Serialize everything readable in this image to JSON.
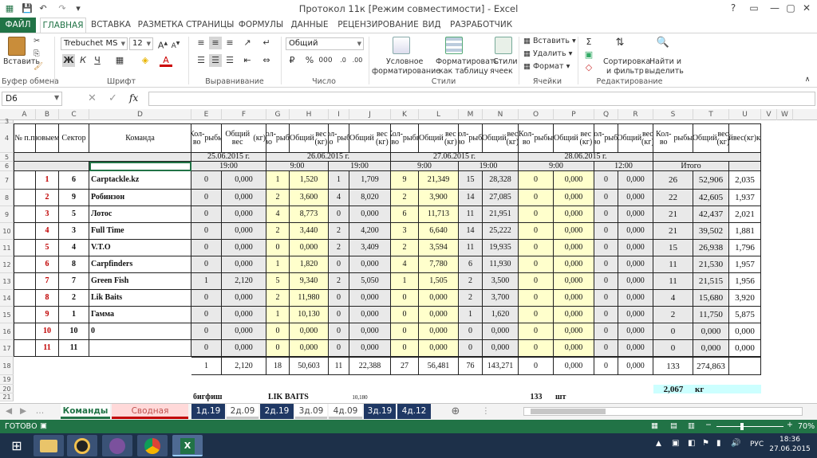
{
  "window": {
    "title": "Протокол 11к  [Режим совместимости] - Excel",
    "help": "?",
    "min": "—",
    "max": "▢",
    "close": "✕"
  },
  "ribbon_tabs": [
    "ФАЙЛ",
    "ГЛАВНАЯ",
    "ВСТАВКА",
    "РАЗМЕТКА СТРАНИЦЫ",
    "ФОРМУЛЫ",
    "ДАННЫЕ",
    "РЕЦЕНЗИРОВАНИЕ",
    "ВИД",
    "РАЗРАБОТЧИК"
  ],
  "ribbon": {
    "paste": "Вставить",
    "clipboard": "Буфер обмена",
    "font_name": "Trebuchet MS",
    "font_size": "12",
    "bold": "Ж",
    "italic": "К",
    "underline": "Ч",
    "font_group": "Шрифт",
    "align_group": "Выравнивание",
    "number_format": "Общий",
    "percent": "%",
    "thousands": "000",
    "number_group": "Число",
    "cond_format": [
      "Условное",
      "форматирование"
    ],
    "format_table": [
      "Форматировать",
      "как таблицу"
    ],
    "cell_styles": [
      "Стили",
      "ячеек"
    ],
    "styles_group": "Стили",
    "insert": "Вставить",
    "delete": "Удалить",
    "format": "Формат",
    "cells_group": "Ячейки",
    "sort": [
      "Сортировка",
      "и фильтр"
    ],
    "find": [
      "Найти и",
      "выделить"
    ],
    "edit_group": "Редактирование"
  },
  "formula_bar": {
    "name_box": "D6",
    "fx": "fx",
    "content": ""
  },
  "columns": [
    "A",
    "B",
    "C",
    "D",
    "E",
    "F",
    "G",
    "H",
    "I",
    "J",
    "K",
    "L",
    "M",
    "N",
    "O",
    "P",
    "Q",
    "R",
    "S",
    "T",
    "U",
    "V",
    "W"
  ],
  "rows": [
    "3",
    "4",
    "5",
    "6",
    "7",
    "8",
    "9",
    "10",
    "11",
    "12",
    "13",
    "14",
    "15",
    "16",
    "17",
    "18",
    "19",
    "20",
    "21"
  ],
  "header": {
    "num": "№ п.п",
    "place": [
      "Призо",
      "вые",
      "места"
    ],
    "sector": "Сектор",
    "team": "Команда",
    "kolvo": [
      "Кол-во",
      "рыбы"
    ],
    "ves": [
      "Общий",
      "вес (кг)"
    ],
    "ves_f": [
      "Общий вес",
      "(кг)"
    ],
    "avg": [
      "Средний",
      "вес(кг)",
      "команды"
    ],
    "dates": [
      "25.06.2015 г.",
      "26.06.2015 г.",
      "27.06.2015 г.",
      "28.06.2015 г."
    ],
    "times": [
      "19:00",
      "9:00",
      "19:00",
      "9:00",
      "19:00",
      "9:00",
      "12:00"
    ],
    "total": "Итого"
  },
  "table_rows": [
    {
      "place": "1",
      "sector": "6",
      "team": "Carptackle.kz",
      "v": [
        "0",
        "0,000",
        "1",
        "1,520",
        "1",
        "1,709",
        "9",
        "21,349",
        "15",
        "28,328",
        "0",
        "0,000",
        "0",
        "0,000",
        "26",
        "52,906",
        "2,035"
      ]
    },
    {
      "place": "2",
      "sector": "9",
      "team": "Робинзон",
      "v": [
        "0",
        "0,000",
        "2",
        "3,600",
        "4",
        "8,020",
        "2",
        "3,900",
        "14",
        "27,085",
        "0",
        "0,000",
        "0",
        "0,000",
        "22",
        "42,605",
        "1,937"
      ]
    },
    {
      "place": "3",
      "sector": "5",
      "team": "Лотос",
      "v": [
        "0",
        "0,000",
        "4",
        "8,773",
        "0",
        "0,000",
        "6",
        "11,713",
        "11",
        "21,951",
        "0",
        "0,000",
        "0",
        "0,000",
        "21",
        "42,437",
        "2,021"
      ]
    },
    {
      "place": "4",
      "sector": "3",
      "team": "Full Time",
      "v": [
        "0",
        "0,000",
        "2",
        "3,440",
        "2",
        "4,200",
        "3",
        "6,640",
        "14",
        "25,222",
        "0",
        "0,000",
        "0",
        "0,000",
        "21",
        "39,502",
        "1,881"
      ]
    },
    {
      "place": "5",
      "sector": "4",
      "team": "V.T.O",
      "v": [
        "0",
        "0,000",
        "0",
        "0,000",
        "2",
        "3,409",
        "2",
        "3,594",
        "11",
        "19,935",
        "0",
        "0,000",
        "0",
        "0,000",
        "15",
        "26,938",
        "1,796"
      ]
    },
    {
      "place": "6",
      "sector": "8",
      "team": "Carpfinders",
      "v": [
        "0",
        "0,000",
        "1",
        "1,820",
        "0",
        "0,000",
        "4",
        "7,780",
        "6",
        "11,930",
        "0",
        "0,000",
        "0",
        "0,000",
        "11",
        "21,530",
        "1,957"
      ]
    },
    {
      "place": "7",
      "sector": "7",
      "team": "Green Fish",
      "v": [
        "1",
        "2,120",
        "5",
        "9,340",
        "2",
        "5,050",
        "1",
        "1,505",
        "2",
        "3,500",
        "0",
        "0,000",
        "0",
        "0,000",
        "11",
        "21,515",
        "1,956"
      ]
    },
    {
      "place": "8",
      "sector": "2",
      "team": "Lik Baits",
      "v": [
        "0",
        "0,000",
        "2",
        "11,980",
        "0",
        "0,000",
        "0",
        "0,000",
        "2",
        "3,700",
        "0",
        "0,000",
        "0",
        "0,000",
        "4",
        "15,680",
        "3,920"
      ]
    },
    {
      "place": "9",
      "sector": "1",
      "team": "Гамма",
      "v": [
        "0",
        "0,000",
        "1",
        "10,130",
        "0",
        "0,000",
        "0",
        "0,000",
        "1",
        "1,620",
        "0",
        "0,000",
        "0",
        "0,000",
        "2",
        "11,750",
        "5,875"
      ]
    },
    {
      "place": "10",
      "sector": "10",
      "team": "0",
      "v": [
        "0",
        "0,000",
        "0",
        "0,000",
        "0",
        "0,000",
        "0",
        "0,000",
        "0",
        "0,000",
        "0",
        "0,000",
        "0",
        "0,000",
        "0",
        "0,000",
        "0,000"
      ]
    },
    {
      "place": "11",
      "sector": "11",
      "team": "",
      "v": [
        "0",
        "0,000",
        "0",
        "0,000",
        "0",
        "0,000",
        "0",
        "0,000",
        "0",
        "0,000",
        "0",
        "0,000",
        "0",
        "0,000",
        "0",
        "0,000",
        "0,000"
      ]
    }
  ],
  "totals": [
    "1",
    "2,120",
    "18",
    "50,603",
    "11",
    "22,388",
    "27",
    "56,481",
    "76",
    "143,271",
    "0",
    "0,000",
    "0",
    "0,000",
    "133",
    "274,863"
  ],
  "row20": {
    "value": "2,067",
    "unit": "кг"
  },
  "row21": {
    "a": "бигфиш",
    "b": "LIK BAITS",
    "c": "10,180",
    "d": "133",
    "e": "шт"
  },
  "sheet_tabs": [
    "Команды",
    "Сводная Таблица",
    "1д.19",
    "2д.09",
    "2д.19",
    "3д.09",
    "4д.09",
    "3д.19",
    "4д.12"
  ],
  "status": {
    "ready": "ГОТОВО",
    "zoom": "70%"
  },
  "taskbar": {
    "lang": "РУС",
    "time": "18:36",
    "date": "27.06.2015"
  }
}
